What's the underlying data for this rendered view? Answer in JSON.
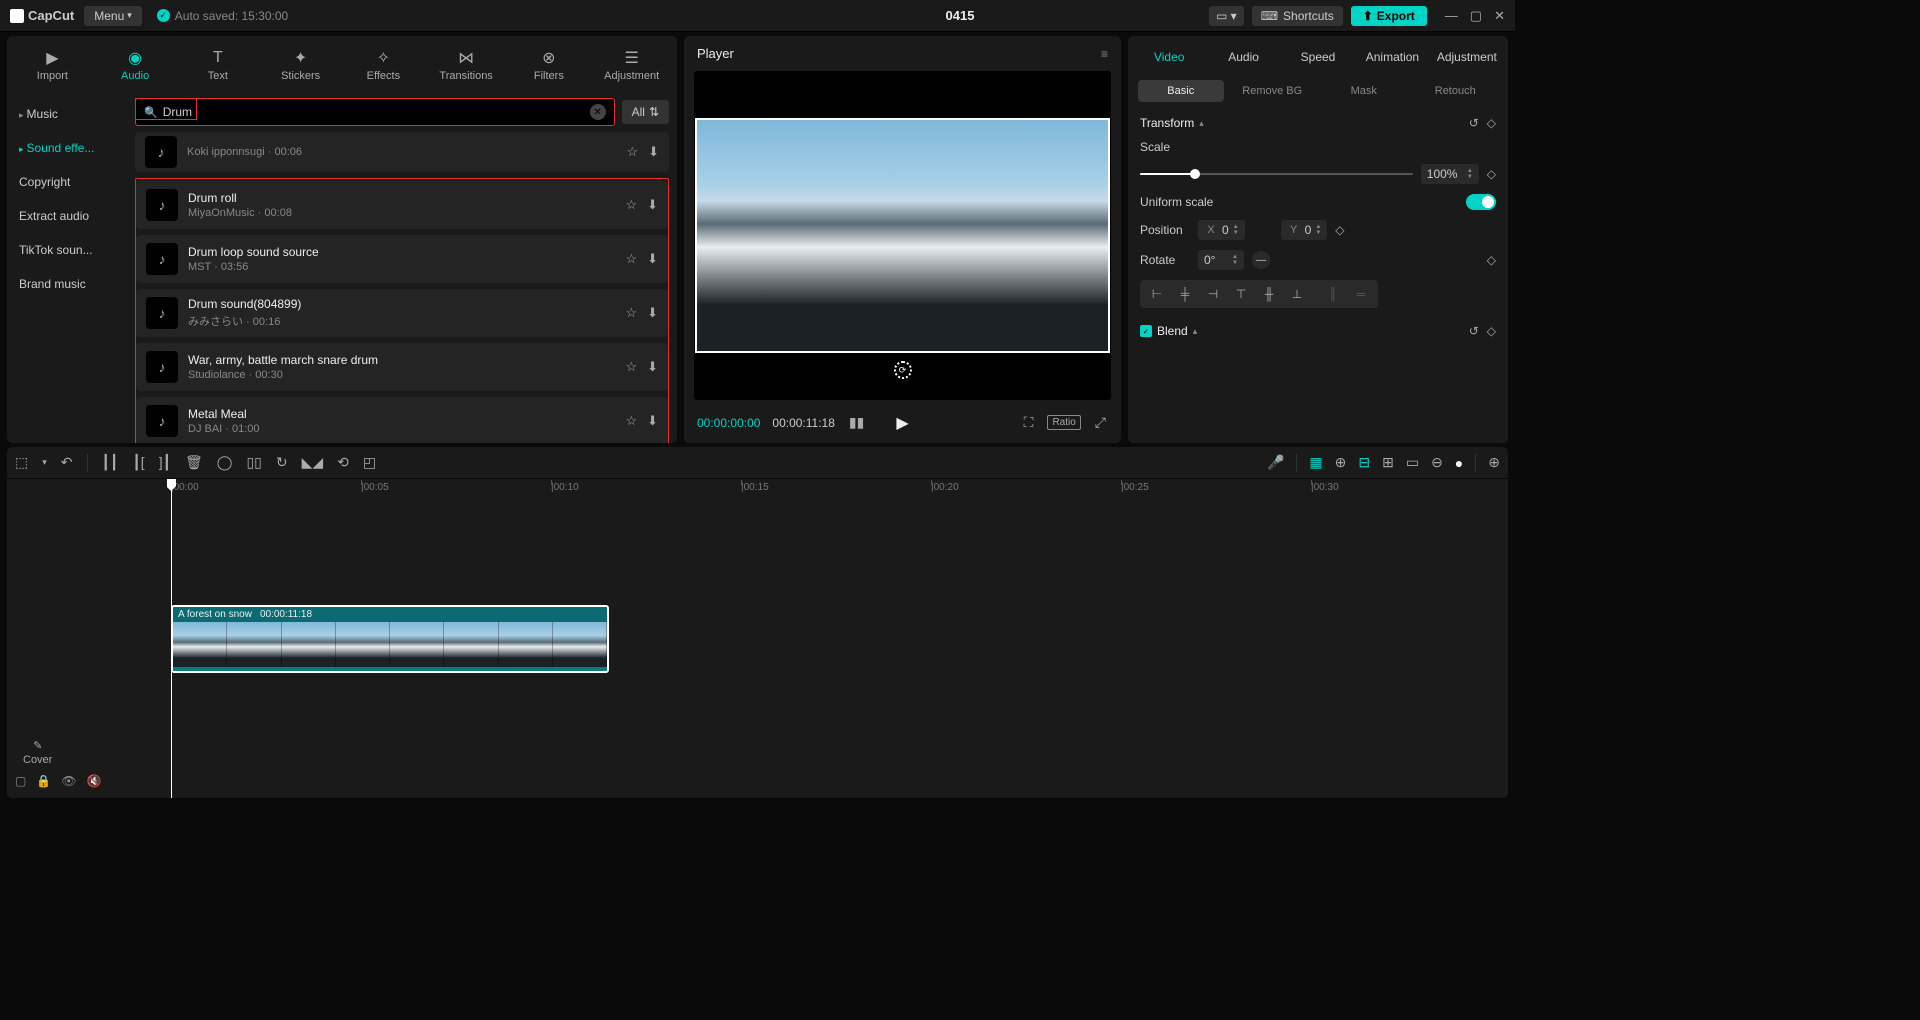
{
  "topbar": {
    "app_name": "CapCut",
    "menu_label": "Menu",
    "autosave_label": "Auto saved: 15:30:00",
    "project_title": "0415",
    "shortcuts_label": "Shortcuts",
    "export_label": "Export"
  },
  "media_tabs": {
    "import": "Import",
    "audio": "Audio",
    "text": "Text",
    "stickers": "Stickers",
    "effects": "Effects",
    "transitions": "Transitions",
    "filters": "Filters",
    "adjustment": "Adjustment"
  },
  "sidebar": {
    "music": "Music",
    "sound_effects": "Sound effe...",
    "copyright": "Copyright",
    "extract_audio": "Extract audio",
    "tiktok_sound": "TikTok soun...",
    "brand_music": "Brand music"
  },
  "search": {
    "value": "Drum",
    "all_label": "All"
  },
  "results_top": {
    "title_partial": "Koki ipponnsugi",
    "dur": "00:06"
  },
  "results": [
    {
      "title": "Drum roll",
      "artist": "MiyaOnMusic",
      "dur": "00:08"
    },
    {
      "title": "Drum loop sound source",
      "artist": "MST",
      "dur": "03:56"
    },
    {
      "title": "Drum sound(804899)",
      "artist": "みみさらい",
      "dur": "00:16"
    },
    {
      "title": "War, army, battle march snare drum",
      "artist": "Studiolance",
      "dur": "00:30"
    },
    {
      "title": "Metal Meal",
      "artist": "DJ BAI",
      "dur": "01:00"
    }
  ],
  "player": {
    "title": "Player",
    "time_current": "00:00:00:00",
    "time_duration": "00:00:11:18",
    "ratio": "Ratio"
  },
  "inspector": {
    "tabs": {
      "video": "Video",
      "audio": "Audio",
      "speed": "Speed",
      "animation": "Animation",
      "adjustment": "Adjustment"
    },
    "subtabs": {
      "basic": "Basic",
      "remove_bg": "Remove BG",
      "mask": "Mask",
      "retouch": "Retouch"
    },
    "section_transform": "Transform",
    "scale_label": "Scale",
    "scale_value": "100%",
    "uniform_scale": "Uniform scale",
    "position_label": "Position",
    "x": "X",
    "y": "Y",
    "x_value": "0",
    "y_value": "0",
    "rotate_label": "Rotate",
    "rotate_value": "0°",
    "blend_label": "Blend"
  },
  "timeline": {
    "ticks": [
      "00:00",
      "00:05",
      "00:10",
      "00:15",
      "00:20",
      "00:25",
      "00:30"
    ],
    "clip_name": "A forest on snow",
    "clip_dur": "00:00:11:18",
    "cover_label": "Cover"
  }
}
